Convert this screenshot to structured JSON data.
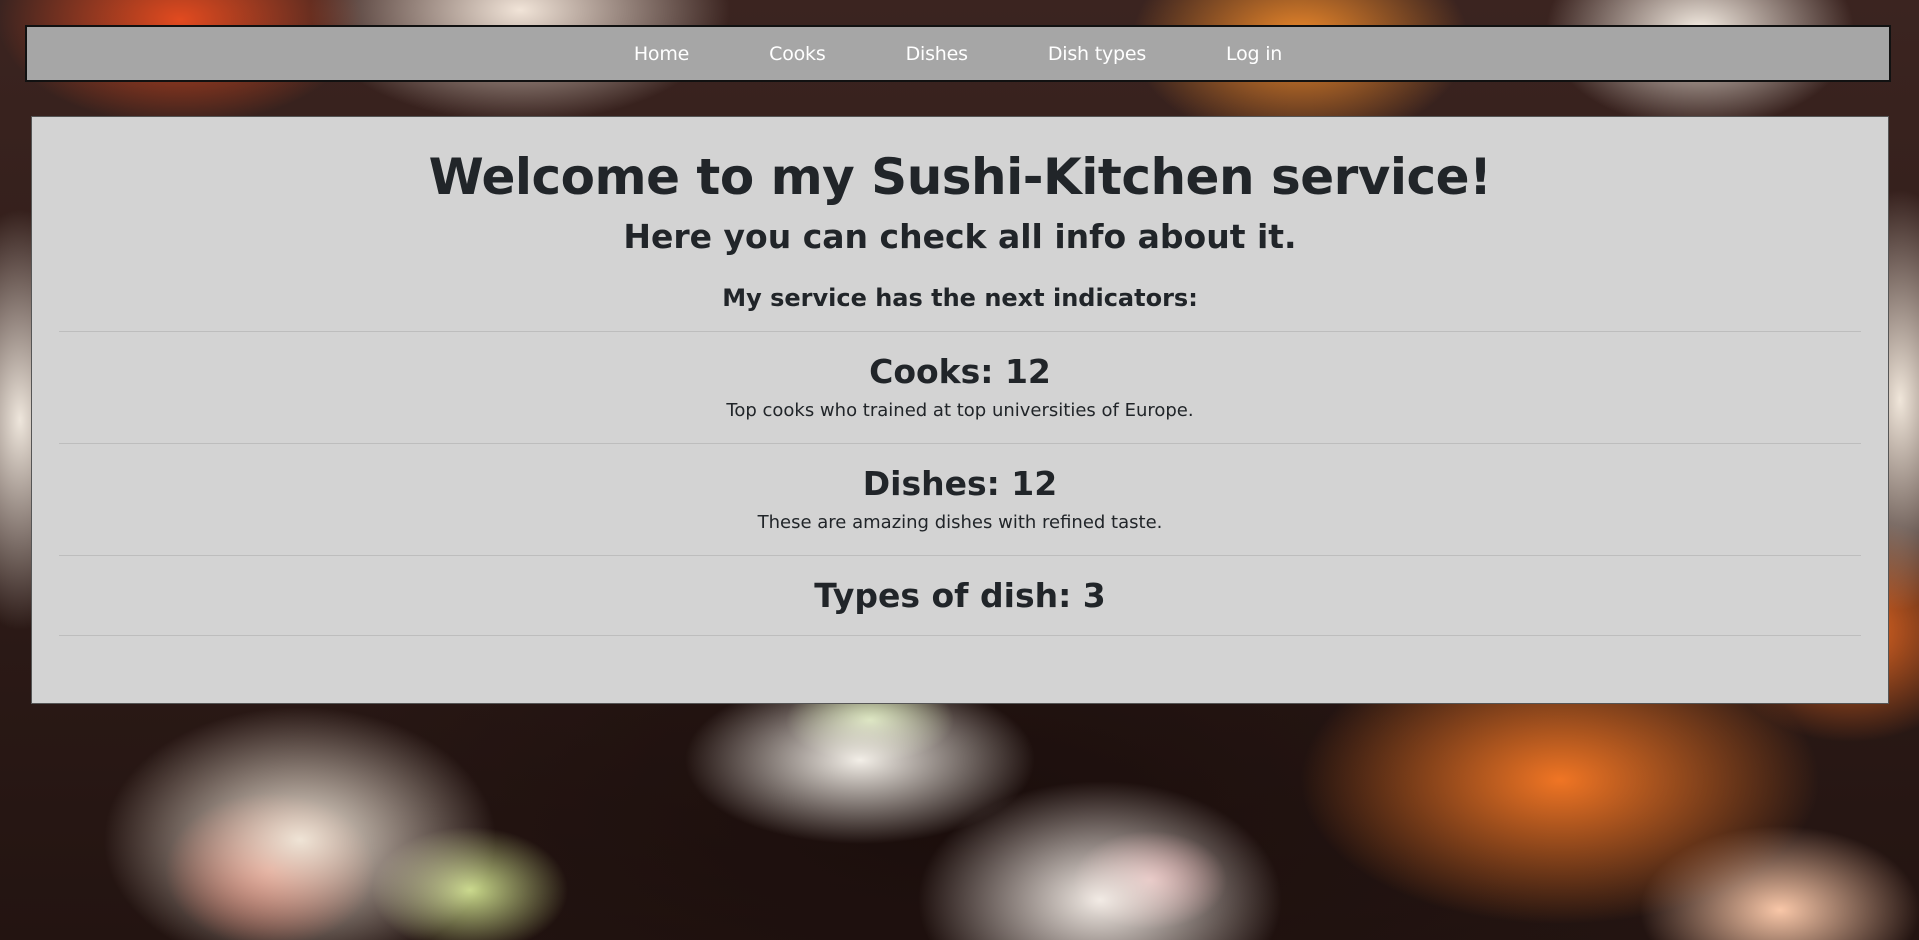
{
  "nav": {
    "items": [
      {
        "label": "Home"
      },
      {
        "label": "Cooks"
      },
      {
        "label": "Dishes"
      },
      {
        "label": "Dish types"
      },
      {
        "label": "Log in"
      }
    ]
  },
  "main": {
    "title": "Welcome to my Sushi-Kitchen service!",
    "subtitle": "Here you can check all info about it.",
    "intro": "My service has the next indicators:",
    "indicators": [
      {
        "heading": "Cooks: 12",
        "description": "Top cooks who trained at top universities of Europe."
      },
      {
        "heading": "Dishes: 12",
        "description": "These are amazing dishes with refined taste."
      },
      {
        "heading": "Types of dish: 3"
      }
    ]
  },
  "colors": {
    "navbar_bg": "#a6a6a6",
    "panel_bg": "#d3d3d3",
    "text": "#212529"
  }
}
